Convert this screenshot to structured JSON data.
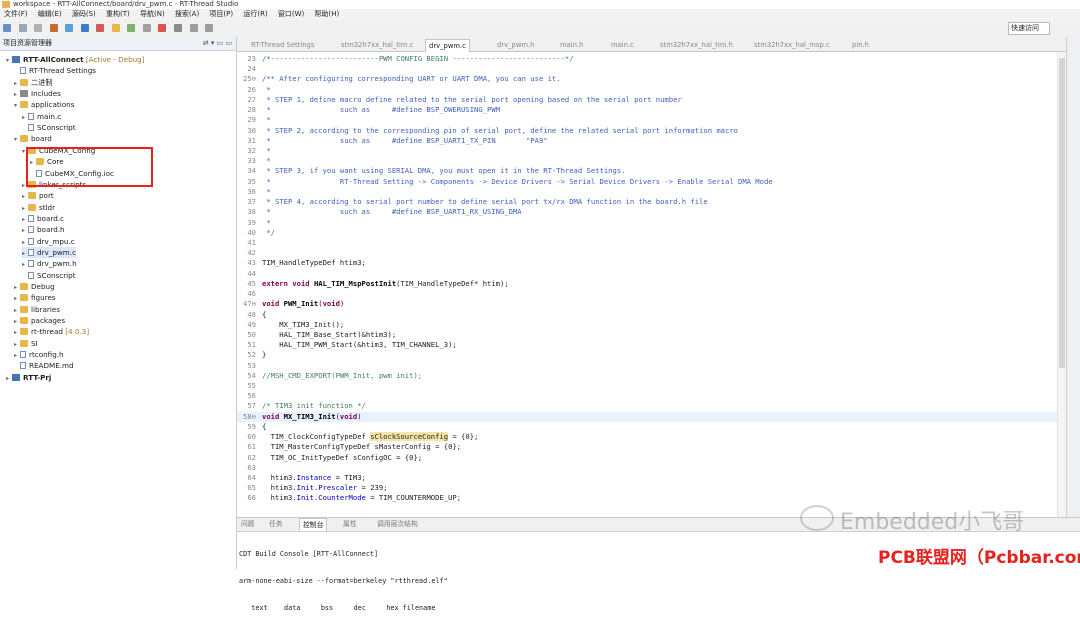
{
  "window_title": "workspace - RTT-AllConnect/board/drv_pwm.c - RT-Thread Studio",
  "menu": [
    "文件(F)",
    "编辑(E)",
    "源码(S)",
    "重构(T)",
    "导航(N)",
    "搜索(A)",
    "项目(P)",
    "运行(R)",
    "窗口(W)",
    "帮助(H)"
  ],
  "quick_access": "快速访问",
  "sidebar": {
    "title": "项目资源管理器",
    "tree": [
      {
        "label": "RTT-AllConnect",
        "badge": "[Active - Debug]",
        "indent": 0,
        "type": "proj",
        "arrow": "▾"
      },
      {
        "label": "RT-Thread Settings",
        "indent": 1,
        "type": "file",
        "arrow": ""
      },
      {
        "label": "二进制",
        "indent": 1,
        "type": "fold",
        "arrow": "▸"
      },
      {
        "label": "Includes",
        "indent": 1,
        "type": "inc",
        "arrow": "▸"
      },
      {
        "label": "applications",
        "indent": 1,
        "type": "fold",
        "arrow": "▾"
      },
      {
        "label": "main.c",
        "indent": 2,
        "type": "file",
        "arrow": "▸"
      },
      {
        "label": "SConscript",
        "indent": 2,
        "type": "file",
        "arrow": ""
      },
      {
        "label": "board",
        "indent": 1,
        "type": "fold",
        "arrow": "▾"
      },
      {
        "label": "CubeMX_Config",
        "indent": 2,
        "type": "fold",
        "arrow": "▾"
      },
      {
        "label": "Core",
        "indent": 3,
        "type": "fold",
        "arrow": "▸"
      },
      {
        "label": "CubeMX_Config.ioc",
        "indent": 3,
        "type": "file",
        "arrow": ""
      },
      {
        "label": "linker_scripts",
        "indent": 2,
        "type": "fold",
        "arrow": "▸"
      },
      {
        "label": "port",
        "indent": 2,
        "type": "fold",
        "arrow": "▸"
      },
      {
        "label": "stldr",
        "indent": 2,
        "type": "fold",
        "arrow": "▸"
      },
      {
        "label": "board.c",
        "indent": 2,
        "type": "file",
        "arrow": "▸"
      },
      {
        "label": "board.h",
        "indent": 2,
        "type": "file",
        "arrow": "▸"
      },
      {
        "label": "drv_mpu.c",
        "indent": 2,
        "type": "file",
        "arrow": "▸"
      },
      {
        "label": "drv_pwm.c",
        "indent": 2,
        "type": "file",
        "arrow": "▸",
        "selected": true
      },
      {
        "label": "drv_pwm.h",
        "indent": 2,
        "type": "file",
        "arrow": "▸"
      },
      {
        "label": "SConscript",
        "indent": 2,
        "type": "file",
        "arrow": ""
      },
      {
        "label": "Debug",
        "indent": 1,
        "type": "fold",
        "arrow": "▸"
      },
      {
        "label": "figures",
        "indent": 1,
        "type": "fold",
        "arrow": "▸"
      },
      {
        "label": "libraries",
        "indent": 1,
        "type": "fold",
        "arrow": "▸"
      },
      {
        "label": "packages",
        "indent": 1,
        "type": "fold",
        "arrow": "▸"
      },
      {
        "label": "rt-thread",
        "badge": "[4.0.3]",
        "indent": 1,
        "type": "fold",
        "arrow": "▸"
      },
      {
        "label": "SI",
        "indent": 1,
        "type": "fold",
        "arrow": "▸"
      },
      {
        "label": "rtconfig.h",
        "indent": 1,
        "type": "file",
        "arrow": "▸"
      },
      {
        "label": "README.md",
        "indent": 1,
        "type": "file",
        "arrow": ""
      },
      {
        "label": "RTT-Prj",
        "indent": 0,
        "type": "proj",
        "arrow": "▸"
      }
    ]
  },
  "editor": {
    "tabs": [
      {
        "label": "RT-Thread Settings",
        "active": false
      },
      {
        "label": "stm32h7xx_hal_tim.c",
        "active": false
      },
      {
        "label": "drv_pwm.c",
        "active": true
      },
      {
        "label": "drv_pwm.h",
        "active": false
      },
      {
        "label": "main.h",
        "active": false
      },
      {
        "label": "main.c",
        "active": false
      },
      {
        "label": "stm32h7xx_hal_tim.h",
        "active": false
      },
      {
        "label": "stm32h7xx_hal_msp.c",
        "active": false
      },
      {
        "label": "pin.h",
        "active": false
      }
    ],
    "lines": [
      {
        "n": "23",
        "t": "/*-------------------------PWM CONFIG BEGIN --------------------------*/",
        "c": "cm"
      },
      {
        "n": "24",
        "t": "",
        "c": ""
      },
      {
        "n": "25⊖",
        "t": "/** After configuring corresponding UART or UART DMA, you can use it.",
        "c": "cmb"
      },
      {
        "n": "26",
        "t": " *",
        "c": "cmb"
      },
      {
        "n": "27",
        "t": " * STEP 1, define macro define related to the serial port opening based on the serial port number",
        "c": "cmb"
      },
      {
        "n": "28",
        "t": " *                such as     #define BSP_OWERUSING_PWM",
        "c": "cmb"
      },
      {
        "n": "29",
        "t": " *",
        "c": "cmb"
      },
      {
        "n": "30",
        "t": " * STEP 2, according to the corresponding pin of serial port, define the related serial port information macro",
        "c": "cmb"
      },
      {
        "n": "31",
        "t": " *                such as     #define BSP_UART1_TX_PIN       \"PA9\"",
        "c": "cmb"
      },
      {
        "n": "32",
        "t": " *",
        "c": "cmb"
      },
      {
        "n": "33",
        "t": " *",
        "c": "cmb"
      },
      {
        "n": "34",
        "t": " * STEP 3, if you want using SERIAL DMA, you must open it in the RT-Thread Settings.",
        "c": "cmb"
      },
      {
        "n": "35",
        "t": " *                RT-Thread Setting -> Components -> Device Drivers -> Serial Device Drivers -> Enable Serial DMA Mode",
        "c": "cmb"
      },
      {
        "n": "36",
        "t": " *",
        "c": "cmb"
      },
      {
        "n": "37",
        "t": " * STEP 4, according to serial port number to define serial port tx/rx DMA function in the board.h file",
        "c": "cmb"
      },
      {
        "n": "38",
        "t": " *                such as     #define BSP_UART1_RX_USING_DMA",
        "c": "cmb"
      },
      {
        "n": "39",
        "t": " *",
        "c": "cmb"
      },
      {
        "n": "40",
        "t": " */",
        "c": "cmb"
      },
      {
        "n": "41",
        "t": "",
        "c": ""
      },
      {
        "n": "42",
        "t": "",
        "c": ""
      },
      {
        "n": "43",
        "t": "TIM_HandleTypeDef htim3;",
        "c": ""
      },
      {
        "n": "44",
        "t": "",
        "c": ""
      },
      {
        "n": "45",
        "t": "extern void HAL_TIM_MspPostInit(TIM_HandleTypeDef* htim);",
        "c": "ext"
      },
      {
        "n": "46",
        "t": "",
        "c": ""
      },
      {
        "n": "47⊖",
        "t": "void PWM_Init(void)",
        "c": "fdecl"
      },
      {
        "n": "48",
        "t": "{",
        "c": ""
      },
      {
        "n": "49",
        "t": "    MX_TIM3_Init();",
        "c": ""
      },
      {
        "n": "50",
        "t": "    HAL_TIM_Base_Start(&htim3);",
        "c": ""
      },
      {
        "n": "51",
        "t": "    HAL_TIM_PWM_Start(&htim3, TIM_CHANNEL_3);",
        "c": ""
      },
      {
        "n": "52",
        "t": "}",
        "c": ""
      },
      {
        "n": "53",
        "t": "",
        "c": ""
      },
      {
        "n": "54",
        "t": "//MSH_CMD_EXPORT(PWM_Init, pwm init);",
        "c": "cm"
      },
      {
        "n": "55",
        "t": "",
        "c": ""
      },
      {
        "n": "56",
        "t": "",
        "c": ""
      },
      {
        "n": "57",
        "t": "/* TIM3 init function */",
        "c": "cm"
      },
      {
        "n": "58⊖",
        "t": "void MX_TIM3_Init(void)",
        "c": "fdecl2"
      },
      {
        "n": "59",
        "t": "{",
        "c": ""
      },
      {
        "n": "60",
        "t": "  TIM_ClockConfigTypeDef sClockSourceConfig = {0};",
        "c": "hlline"
      },
      {
        "n": "61",
        "t": "  TIM_MasterConfigTypeDef sMasterConfig = {0};",
        "c": ""
      },
      {
        "n": "62",
        "t": "  TIM_OC_InitTypeDef sConfigOC = {0};",
        "c": ""
      },
      {
        "n": "63",
        "t": "",
        "c": ""
      },
      {
        "n": "64",
        "t": "  htim3.Instance = TIM3;",
        "c": ""
      },
      {
        "n": "65",
        "t": "  htim3.Init.Prescaler = 239;",
        "c": ""
      },
      {
        "n": "66",
        "t": "  htim3.Init.CounterMode = TIM_COUNTERMODE_UP;",
        "c": ""
      }
    ]
  },
  "bottom": {
    "tabs": [
      {
        "label": "问题",
        "active": false
      },
      {
        "label": "任务",
        "active": false
      },
      {
        "label": "控制台",
        "active": true
      },
      {
        "label": "属性",
        "active": false
      },
      {
        "label": "调用层次结构",
        "active": false
      }
    ],
    "console_title": "CDT Build Console [RTT-AllConnect]",
    "console_lines": [
      "arm-none-eabi-size --format=berkeley \"rtthread.elf\"",
      "   text    data     bss     dec     hex filename"
    ]
  },
  "watermark_1": "Embedded小飞哥",
  "watermark_2": "PCB联盟网（Pcbbar.com）"
}
